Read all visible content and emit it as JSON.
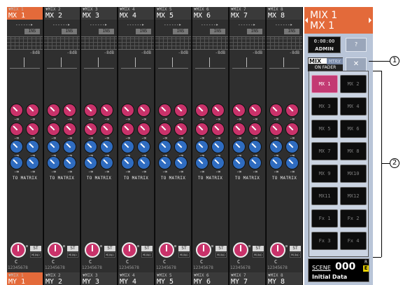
{
  "strips": [
    {
      "header_small": "▼MIX 1",
      "header": "MX 1",
      "footer_small": "▼MIX 1",
      "footer": "MY 1",
      "selected": true
    },
    {
      "header_small": "▼MIX 2",
      "header": "MX 2",
      "footer_small": "▼MIX 2",
      "footer": "MY 2",
      "selected": false
    },
    {
      "header_small": "▼MIX 3",
      "header": "MX 3",
      "footer_small": "▼MIX 3",
      "footer": "MY 3",
      "selected": false
    },
    {
      "header_small": "▼MIX 4",
      "header": "MX 4",
      "footer_small": "▼MIX 4",
      "footer": "MY 4",
      "selected": false
    },
    {
      "header_small": "▼MIX 5",
      "header": "MX 5",
      "footer_small": "▼MIX 5",
      "footer": "MY 5",
      "selected": false
    },
    {
      "header_small": "▼MIX 6",
      "header": "MX 6",
      "footer_small": "▼MIX 6",
      "footer": "MY 6",
      "selected": false
    },
    {
      "header_small": "▼MIX 7",
      "header": "MX 7",
      "footer_small": "▼MIX 7",
      "footer": "MY 7",
      "selected": false
    },
    {
      "header_small": "▼MIX 8",
      "header": "MX 8",
      "footer_small": "▼MIX 8",
      "footer": "MY 8",
      "selected": false
    }
  ],
  "strip_labels": {
    "ins": "INS",
    "db": "-8dB",
    "inf": "-∞",
    "to_matrix": "TO MATRIX",
    "st": "ST",
    "mono": "MONO",
    "center": "C",
    "matrix_nums": "12345678"
  },
  "right_panel": {
    "selected_line1": "MIX 1",
    "selected_line2": "MX 1",
    "time": "0:00:00",
    "user": "ADMIN",
    "help_label": "?",
    "mix_label": "MIX",
    "mtrx_label": "MTRX",
    "on_fader_label": "ON FADER",
    "close_label": "✕"
  },
  "channel_select": [
    {
      "label": "MX 1",
      "on": true
    },
    {
      "label": "MX 2",
      "on": false
    },
    {
      "label": "MX 3",
      "on": false
    },
    {
      "label": "MX 4",
      "on": false
    },
    {
      "label": "MX 5",
      "on": false
    },
    {
      "label": "MX 6",
      "on": false
    },
    {
      "label": "MX 7",
      "on": false
    },
    {
      "label": "MX 8",
      "on": false
    },
    {
      "label": "MX 9",
      "on": false
    },
    {
      "label": "MX10",
      "on": false
    },
    {
      "label": "MX11",
      "on": false
    },
    {
      "label": "MX12",
      "on": false
    },
    {
      "label": "Fx 1",
      "on": false
    },
    {
      "label": "Fx 2",
      "on": false
    },
    {
      "label": "Fx 3",
      "on": false
    },
    {
      "label": "Fx 4",
      "on": false
    }
  ],
  "scene": {
    "label": "SCENE",
    "number": "000",
    "r": "R",
    "e": "E",
    "title": "Initial Data"
  },
  "callouts": [
    "1",
    "2"
  ],
  "colors": {
    "selected_orange": "#e36a3a",
    "send_pink": "#c9326a",
    "send_blue": "#2f6cc0",
    "active_channel": "#c33a73",
    "panel_bg": "#b9c5d8"
  }
}
